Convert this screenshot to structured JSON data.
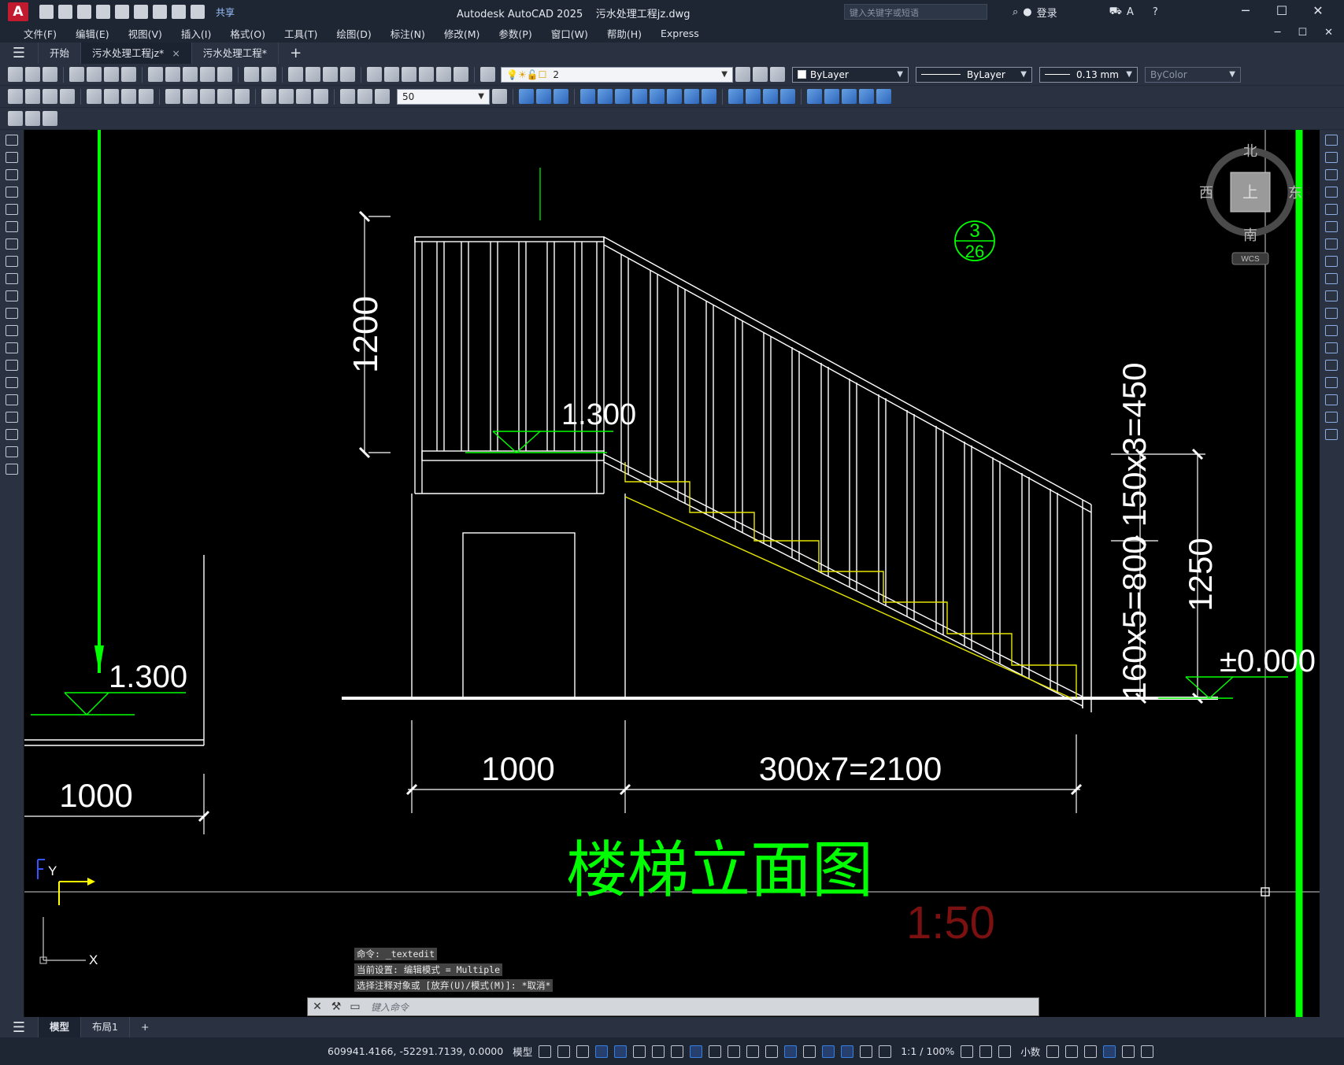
{
  "app": {
    "logo_letter": "A",
    "title": "Autodesk AutoCAD 2025",
    "file_name": "污水处理工程jz.dwg",
    "share_label": "共享",
    "search_placeholder": "键入关键字或短语",
    "login_label": "登录"
  },
  "window_controls": {
    "minimize": "─",
    "restore": "☐",
    "close": "✕"
  },
  "menu": {
    "items": [
      "文件(F)",
      "编辑(E)",
      "视图(V)",
      "插入(I)",
      "格式(O)",
      "工具(T)",
      "绘图(D)",
      "标注(N)",
      "修改(M)",
      "参数(P)",
      "窗口(W)",
      "帮助(H)",
      "Express"
    ]
  },
  "doc_tabs": {
    "start": "开始",
    "tabs": [
      "污水处理工程jz*",
      "污水处理工程*"
    ],
    "close_glyph": "×",
    "add_glyph": "+"
  },
  "properties": {
    "layer": "2",
    "color": "ByLayer",
    "linetype": "ByLayer",
    "lineweight": "0.13 mm",
    "plotstyle": "ByColor",
    "dimscale": "50"
  },
  "viewcube": {
    "north": "北",
    "south": "南",
    "east": "东",
    "west": "西",
    "face": "上",
    "wcs": "WCS"
  },
  "drawing": {
    "dim_1200": "1200",
    "elev_top": "1.300",
    "elev_left": "1.300",
    "dim_150x3": "150x3=450",
    "dim_160x5": "160x5=800",
    "dim_1250": "1250",
    "elev_zero": "±0.000",
    "dim_1000": "1000",
    "dim_300x7": "300x7=2100",
    "dim_left_1000": "1000",
    "title": "楼梯立面图",
    "scale": "1:50",
    "section_num": "3",
    "section_sheet": "26",
    "ucs_y": "Y",
    "ucs_x": "X"
  },
  "command": {
    "history": [
      "命令: _textedit",
      "当前设置: 编辑模式 = Multiple",
      "选择注释对象或 [放弃(U)/模式(M)]: *取消*"
    ],
    "placeholder": "键入命令"
  },
  "layout_tabs": {
    "model": "模型",
    "layout1": "布局1",
    "add": "+"
  },
  "status": {
    "coords": "609941.4166, -52291.7139, 0.0000",
    "model_label": "模型",
    "scale": "1:1 / 100%",
    "units": "小数"
  },
  "colors": {
    "canvas_bg": "#000000",
    "drawing_white": "#ffffff",
    "green": "#00ff00",
    "yellow": "#e6e600",
    "scale_red": "#7a1010"
  }
}
